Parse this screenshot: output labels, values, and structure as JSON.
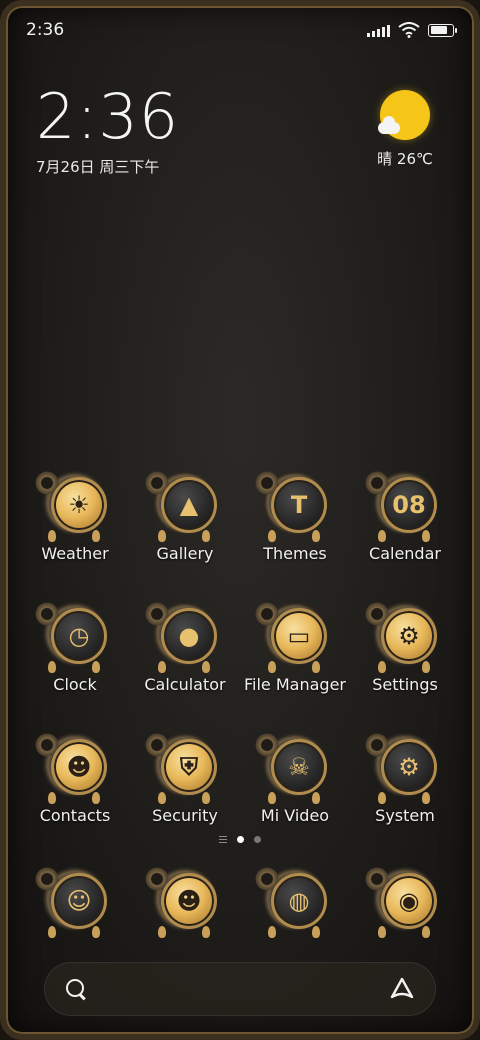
{
  "status": {
    "time": "2:36"
  },
  "clock_widget": {
    "time": "2:36",
    "date": "7月26日 周三下午"
  },
  "weather_widget": {
    "condition_temp": "晴 26℃"
  },
  "apps": [
    [
      {
        "label": "Weather",
        "icon": "weather-icon",
        "glyph": "☀",
        "dark": false
      },
      {
        "label": "Gallery",
        "icon": "gallery-icon",
        "glyph": "▲",
        "dark": true
      },
      {
        "label": "Themes",
        "icon": "themes-icon",
        "glyph": "T",
        "dark": true
      },
      {
        "label": "Calendar",
        "icon": "calendar-icon",
        "glyph": "08",
        "dark": true
      }
    ],
    [
      {
        "label": "Clock",
        "icon": "clock-icon",
        "glyph": "◷",
        "dark": true
      },
      {
        "label": "Calculator",
        "icon": "calculator-icon",
        "glyph": "●",
        "dark": true
      },
      {
        "label": "File Manager",
        "icon": "file-manager-icon",
        "glyph": "▭",
        "dark": false
      },
      {
        "label": "Settings",
        "icon": "settings-icon",
        "glyph": "⚙",
        "dark": false
      }
    ],
    [
      {
        "label": "Contacts",
        "icon": "contacts-icon",
        "glyph": "☻",
        "dark": false
      },
      {
        "label": "Security",
        "icon": "security-icon",
        "glyph": "⛨",
        "dark": false
      },
      {
        "label": "Mi Video",
        "icon": "mi-video-icon",
        "glyph": "☠",
        "dark": true
      },
      {
        "label": "System",
        "icon": "system-icon",
        "glyph": "⚙",
        "dark": true
      }
    ]
  ],
  "dock": [
    {
      "icon": "smiley-icon",
      "glyph": "☺",
      "dark": true
    },
    {
      "icon": "messages-icon",
      "glyph": "☻",
      "dark": false
    },
    {
      "icon": "browser-globe-icon",
      "glyph": "◍",
      "dark": true
    },
    {
      "icon": "camera-icon",
      "glyph": "◉",
      "dark": false
    }
  ],
  "page_indicator": {
    "pages": 2,
    "active": 1
  }
}
